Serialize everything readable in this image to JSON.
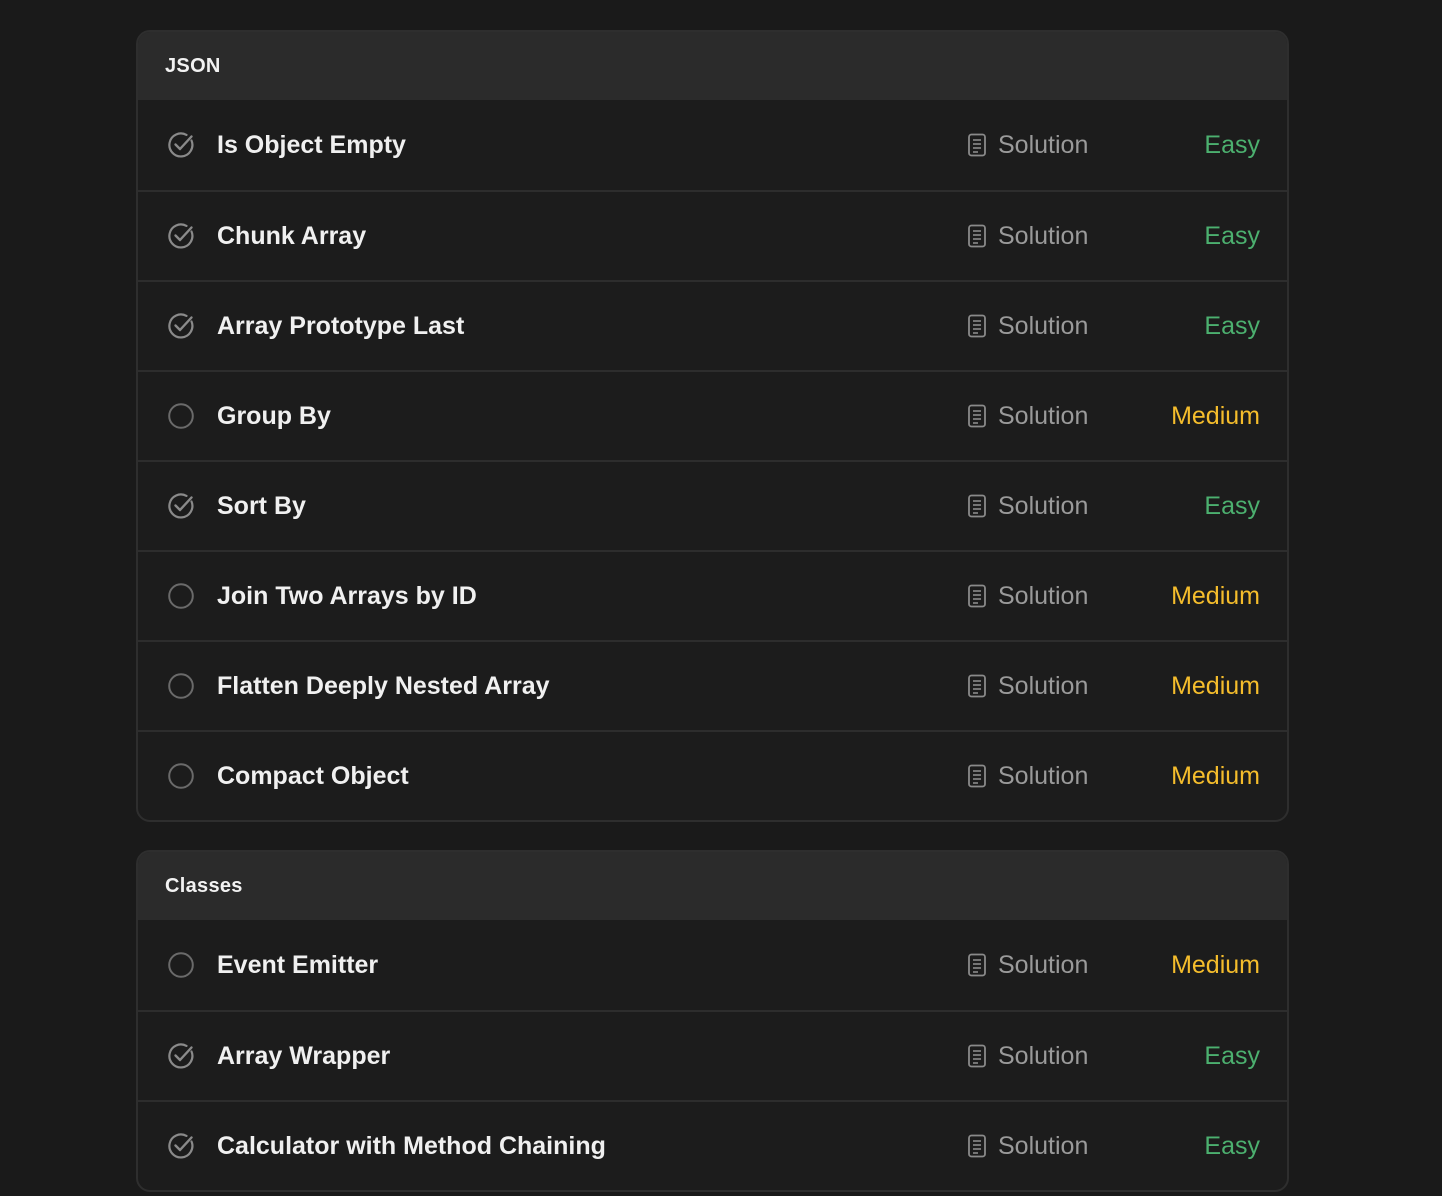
{
  "colors": {
    "background": "#1a1a1a",
    "header": "#2b2b2b",
    "easy": "#4cb06f",
    "medium": "#f5bd2c"
  },
  "sections": [
    {
      "title": "JSON",
      "problems": [
        {
          "title": "Is Object Empty",
          "solution_label": "Solution",
          "difficulty": "Easy",
          "solved": true
        },
        {
          "title": "Chunk Array",
          "solution_label": "Solution",
          "difficulty": "Easy",
          "solved": true
        },
        {
          "title": "Array Prototype Last",
          "solution_label": "Solution",
          "difficulty": "Easy",
          "solved": true
        },
        {
          "title": "Group By",
          "solution_label": "Solution",
          "difficulty": "Medium",
          "solved": false
        },
        {
          "title": "Sort By",
          "solution_label": "Solution",
          "difficulty": "Easy",
          "solved": true
        },
        {
          "title": "Join Two Arrays by ID",
          "solution_label": "Solution",
          "difficulty": "Medium",
          "solved": false
        },
        {
          "title": "Flatten Deeply Nested Array",
          "solution_label": "Solution",
          "difficulty": "Medium",
          "solved": false
        },
        {
          "title": "Compact Object",
          "solution_label": "Solution",
          "difficulty": "Medium",
          "solved": false
        }
      ]
    },
    {
      "title": "Classes",
      "problems": [
        {
          "title": "Event Emitter",
          "solution_label": "Solution",
          "difficulty": "Medium",
          "solved": false
        },
        {
          "title": "Array Wrapper",
          "solution_label": "Solution",
          "difficulty": "Easy",
          "solved": true
        },
        {
          "title": "Calculator with Method Chaining",
          "solution_label": "Solution",
          "difficulty": "Easy",
          "solved": true
        }
      ]
    }
  ]
}
